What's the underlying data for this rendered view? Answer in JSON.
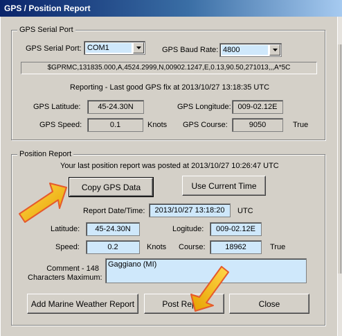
{
  "window": {
    "title": "GPS / Position Report"
  },
  "serial": {
    "group_title": "GPS Serial Port",
    "port_label": "GPS Serial Port:",
    "port_value": "COM1",
    "baud_label": "GPS Baud Rate:",
    "baud_value": "4800",
    "nmea": "$GPRMC,131835.000,A,4524.2999,N,00902.1247,E,0.13,90.50,271013,,,A*5C",
    "status": "Reporting - Last good GPS fix at 2013/10/27 13:18:35 UTC",
    "lat_label": "GPS Latitude:",
    "lat_value": "45-24.30N",
    "lon_label": "GPS Longitude:",
    "lon_value": "009-02.12E",
    "speed_label": "GPS Speed:",
    "speed_value": "0.1",
    "speed_unit": "Knots",
    "course_label": "GPS Course:",
    "course_value": "9050",
    "course_unit": "True"
  },
  "report": {
    "group_title": "Position Report",
    "last_posted": "Your last position report was posted at 2013/10/27 10:26:47 UTC",
    "copy_button": "Copy GPS Data",
    "current_time_button": "Use Current Time",
    "date_label": "Report Date/Time:",
    "date_value": "2013/10/27 13:18:20",
    "date_unit": "UTC",
    "lat_label": "Latitude:",
    "lat_value": "45-24.30N",
    "lon_label": "Logitude:",
    "lon_value": "009-02.12E",
    "speed_label": "Speed:",
    "speed_value": "0.2",
    "speed_unit": "Knots",
    "course_label": "Course:",
    "course_value": "18962",
    "course_unit": "True",
    "comment_label_1": "Comment - 148",
    "comment_label_2": "Characters Maximum:",
    "comment_value": "Gaggiano (MI)"
  },
  "buttons": {
    "weather": "Add Marine Weather Report",
    "post": "Post Report",
    "close": "Close"
  },
  "colors": {
    "title_bar": "#0a246a",
    "field_highlight": "#cfe8fb",
    "annotation_arrow": "#f5b800"
  }
}
